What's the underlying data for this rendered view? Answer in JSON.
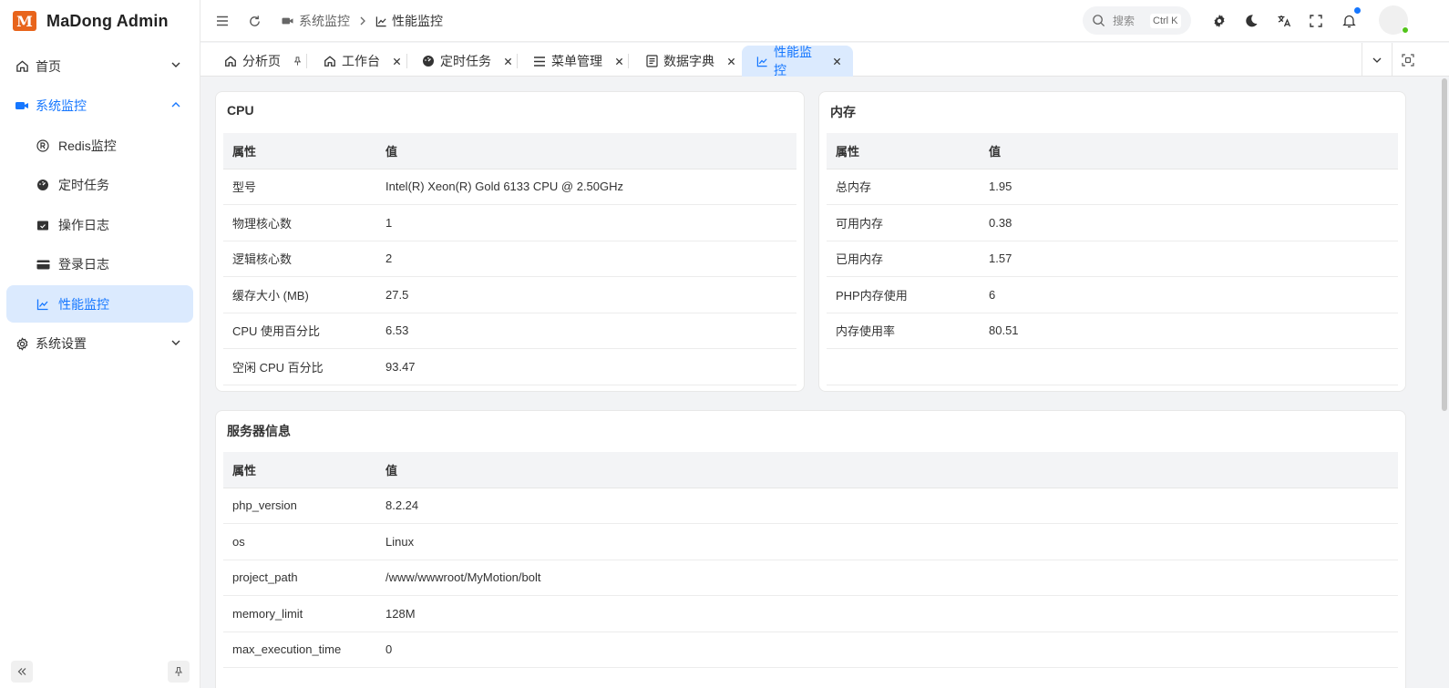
{
  "brand": {
    "logo_text": "M",
    "title": "MaDong Admin"
  },
  "sidebar": {
    "items": [
      {
        "label": "首页",
        "icon": "home-icon"
      },
      {
        "label": "系统监控",
        "icon": "monitor-icon"
      },
      {
        "label": "Redis监控",
        "icon": "registered-icon"
      },
      {
        "label": "定时任务",
        "icon": "gauge-icon"
      },
      {
        "label": "操作日志",
        "icon": "calendar-check-icon"
      },
      {
        "label": "登录日志",
        "icon": "credit-card-icon"
      },
      {
        "label": "性能监控",
        "icon": "chart-line-icon"
      },
      {
        "label": "系统设置",
        "icon": "gear-icon"
      }
    ]
  },
  "header": {
    "breadcrumb": [
      {
        "label": "系统监控",
        "icon": "monitor-icon"
      },
      {
        "label": "性能监控",
        "icon": "chart-line-icon"
      }
    ],
    "search": {
      "label": "搜索",
      "shortcut": "Ctrl K"
    }
  },
  "tabs": [
    {
      "label": "分析页",
      "icon": "home-icon",
      "action": "pin-icon"
    },
    {
      "label": "工作台",
      "icon": "home-icon",
      "action": "close-icon"
    },
    {
      "label": "定时任务",
      "icon": "gauge-icon",
      "action": "close-icon"
    },
    {
      "label": "菜单管理",
      "icon": "menu-icon",
      "action": "close-icon"
    },
    {
      "label": "数据字典",
      "icon": "book-icon",
      "action": "close-icon"
    },
    {
      "label": "性能监控",
      "icon": "chart-line-icon",
      "action": "close-icon"
    }
  ],
  "cpu": {
    "title": "CPU",
    "headers": [
      "属性",
      "值"
    ],
    "rows": [
      [
        "型号",
        "Intel(R) Xeon(R) Gold 6133 CPU @ 2.50GHz"
      ],
      [
        "物理核心数",
        "1"
      ],
      [
        "逻辑核心数",
        "2"
      ],
      [
        "缓存大小 (MB)",
        "27.5"
      ],
      [
        "CPU 使用百分比",
        "6.53"
      ],
      [
        "空闲 CPU 百分比",
        "93.47"
      ]
    ]
  },
  "memory": {
    "title": "内存",
    "headers": [
      "属性",
      "值"
    ],
    "rows": [
      [
        "总内存",
        "1.95"
      ],
      [
        "可用内存",
        "0.38"
      ],
      [
        "已用内存",
        "1.57"
      ],
      [
        "PHP内存使用",
        "6"
      ],
      [
        "内存使用率",
        "80.51"
      ]
    ]
  },
  "server": {
    "title": "服务器信息",
    "headers": [
      "属性",
      "值"
    ],
    "rows": [
      [
        "php_version",
        "8.2.24"
      ],
      [
        "os",
        "Linux"
      ],
      [
        "project_path",
        "/www/wwwroot/MyMotion/bolt"
      ],
      [
        "memory_limit",
        "128M"
      ],
      [
        "max_execution_time",
        "0"
      ]
    ]
  },
  "colors": {
    "accent": "#1677ff",
    "active_bg": "#dbeafe",
    "brand": "#e8641b",
    "online": "#52c41a"
  }
}
